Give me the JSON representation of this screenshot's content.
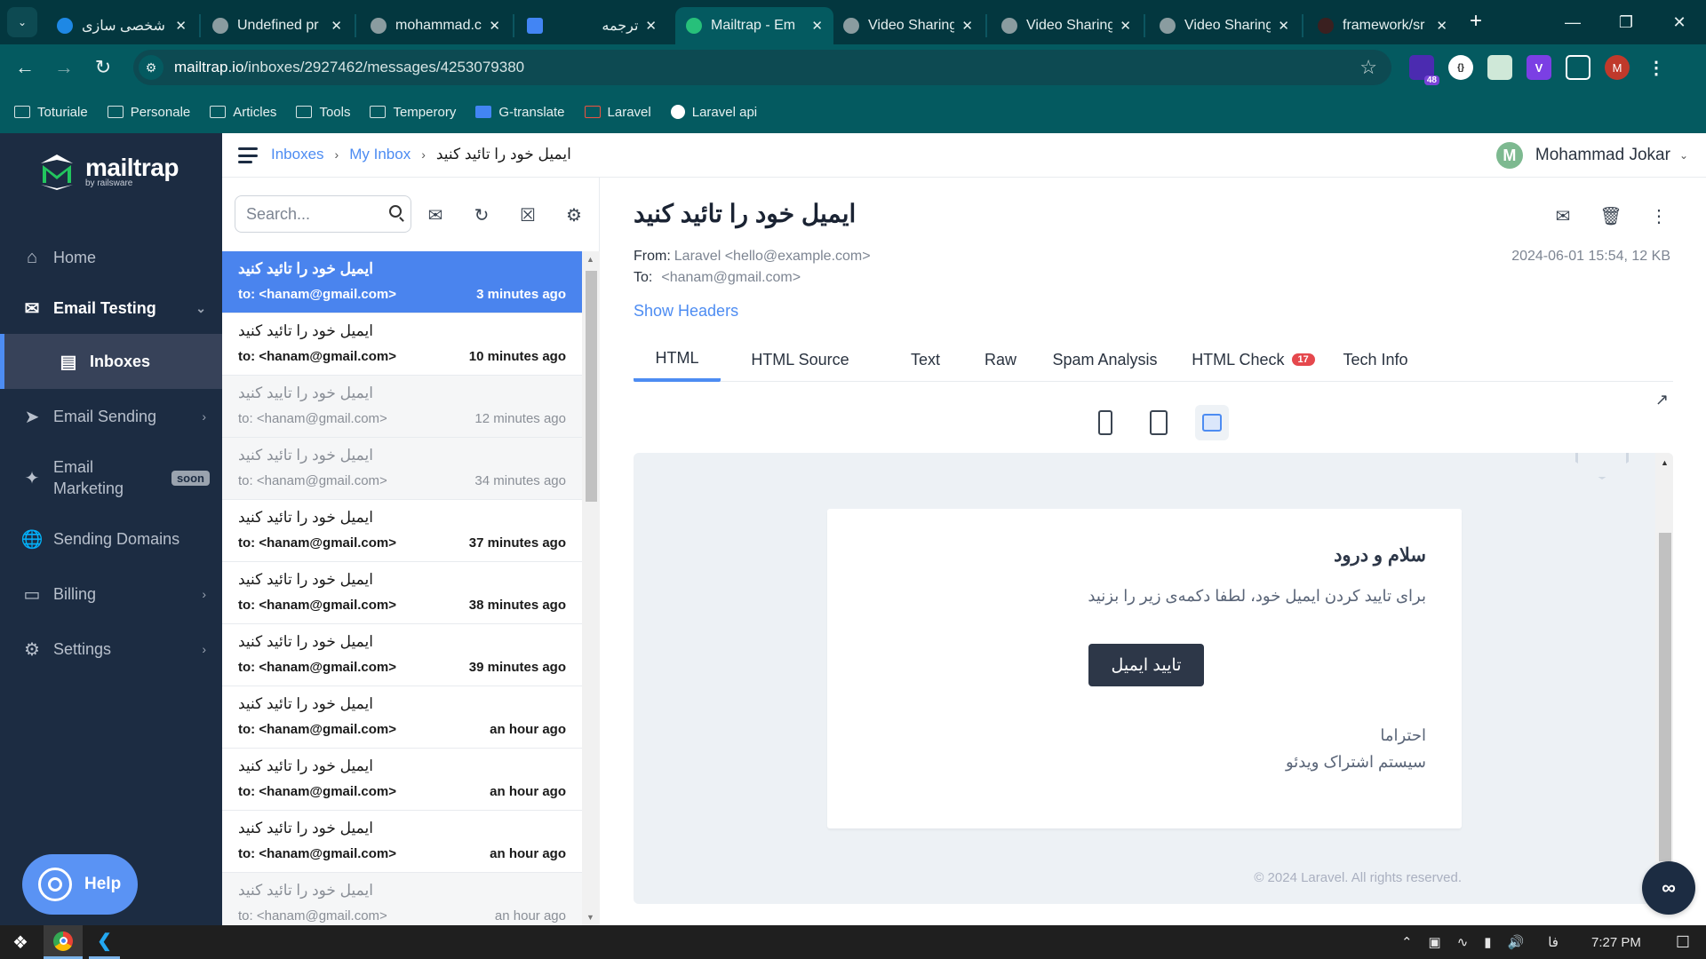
{
  "browser": {
    "tabs": [
      {
        "title": "شخصی سازی",
        "icon": "app-icon",
        "active": false
      },
      {
        "title": "Undefined pr",
        "icon": "globe-icon",
        "active": false
      },
      {
        "title": "mohammad.c",
        "icon": "site-icon",
        "active": false
      },
      {
        "title": "ترجمه",
        "icon": "google-translate-icon",
        "active": false
      },
      {
        "title": "Mailtrap - Em",
        "icon": "mailtrap-icon",
        "active": true
      },
      {
        "title": "Video Sharing",
        "icon": "globe-icon",
        "active": false
      },
      {
        "title": "Video Sharing",
        "icon": "globe-icon",
        "active": false
      },
      {
        "title": "Video Sharing",
        "icon": "globe-icon",
        "active": false
      },
      {
        "title": "framework/sr",
        "icon": "github-icon",
        "active": false
      }
    ],
    "new_tab": "+",
    "url_host": "mailtrap.io",
    "url_path": "/inboxes/2927462/messages/4253079380",
    "extensions_badge": "48",
    "profile_initial": "M",
    "bookmarks": [
      {
        "label": "Toturiale",
        "icon": "folder-icon"
      },
      {
        "label": "Personale",
        "icon": "folder-icon"
      },
      {
        "label": "Articles",
        "icon": "folder-icon"
      },
      {
        "label": "Tools",
        "icon": "folder-icon"
      },
      {
        "label": "Temperory",
        "icon": "folder-icon"
      },
      {
        "label": "G-translate",
        "icon": "google-translate-icon"
      },
      {
        "label": "Laravel",
        "icon": "laravel-icon"
      },
      {
        "label": "Laravel api",
        "icon": "globe-icon"
      }
    ]
  },
  "sidebar": {
    "brand": "mailtrap",
    "brand_sub": "by railsware",
    "items": [
      {
        "label": "Home",
        "icon": "home-icon"
      },
      {
        "label": "Email Testing",
        "icon": "email-testing-icon"
      },
      {
        "label": "Inboxes",
        "icon": "inbox-icon"
      },
      {
        "label": "Email Sending",
        "icon": "send-icon"
      },
      {
        "label": "Email Marketing",
        "icon": "sparkle-icon",
        "badge": "soon"
      },
      {
        "label": "Sending Domains",
        "icon": "globe-icon"
      },
      {
        "label": "Billing",
        "icon": "card-icon"
      },
      {
        "label": "Settings",
        "icon": "gear-icon"
      }
    ],
    "help": "Help"
  },
  "header": {
    "breadcrumb": [
      "Inboxes",
      "My Inbox",
      "ایمیل خود را تائید کنید"
    ],
    "user_initial": "M",
    "user_name": "Mohammad Jokar"
  },
  "list": {
    "search_placeholder": "Search...",
    "messages": [
      {
        "subject": "ایمیل خود را تائید کنید",
        "to": "to: <hanam@gmail.com>",
        "time": "3 minutes ago",
        "state": "selected"
      },
      {
        "subject": "ایمیل خود را تائید کنید",
        "to": "to: <hanam@gmail.com>",
        "time": "10 minutes ago",
        "state": "unread"
      },
      {
        "subject": "ایمیل خود را تایید کنید",
        "to": "to: <hanam@gmail.com>",
        "time": "12 minutes ago",
        "state": "read"
      },
      {
        "subject": "ایمیل خود را تائید کنید",
        "to": "to: <hanam@gmail.com>",
        "time": "34 minutes ago",
        "state": "read"
      },
      {
        "subject": "ایمیل خود را تائید کنید",
        "to": "to: <hanam@gmail.com>",
        "time": "37 minutes ago",
        "state": "unread"
      },
      {
        "subject": "ایمیل خود را تائید کنید",
        "to": "to: <hanam@gmail.com>",
        "time": "38 minutes ago",
        "state": "unread"
      },
      {
        "subject": "ایمیل خود را تائید کنید",
        "to": "to: <hanam@gmail.com>",
        "time": "39 minutes ago",
        "state": "unread"
      },
      {
        "subject": "ایمیل خود را تائید کنید",
        "to": "to: <hanam@gmail.com>",
        "time": "an hour ago",
        "state": "unread"
      },
      {
        "subject": "ایمیل خود را تائید کنید",
        "to": "to: <hanam@gmail.com>",
        "time": "an hour ago",
        "state": "unread"
      },
      {
        "subject": "ایمیل خود را تائید کنید",
        "to": "to: <hanam@gmail.com>",
        "time": "an hour ago",
        "state": "unread"
      },
      {
        "subject": "ایمیل خود را تائید کنید",
        "to": "to: <hanam@gmail.com>",
        "time": "an hour ago",
        "state": "read"
      }
    ]
  },
  "message": {
    "subject": "ایمیل خود را تائید کنید",
    "from_label": "From:",
    "from_value": "Laravel <hello@example.com>",
    "to_label": "To:",
    "to_value": "<hanam@gmail.com>",
    "meta": "2024-06-01 15:54, 12 KB",
    "show_headers": "Show Headers",
    "tabs": [
      {
        "label": "HTML",
        "active": true
      },
      {
        "label": "HTML Source"
      },
      {
        "label": "Text"
      },
      {
        "label": "Raw"
      },
      {
        "label": "Spam Analysis"
      },
      {
        "label": "HTML Check",
        "badge": "17"
      },
      {
        "label": "Tech Info"
      }
    ],
    "devices": [
      "mobile",
      "tablet",
      "desktop"
    ],
    "active_device": "desktop"
  },
  "email_body": {
    "greeting": "سلام و درود",
    "text": "برای تایید کردن ایمیل خود، لطفا دکمه‌ی زیر را بزنید",
    "button": "تایید ایمیل",
    "regards": "احتراما",
    "signature": "سیستم اشتراک ویدئو",
    "footer": "© 2024 Laravel. All rights reserved."
  },
  "taskbar": {
    "time": "7:27 PM",
    "lang": "فا"
  }
}
